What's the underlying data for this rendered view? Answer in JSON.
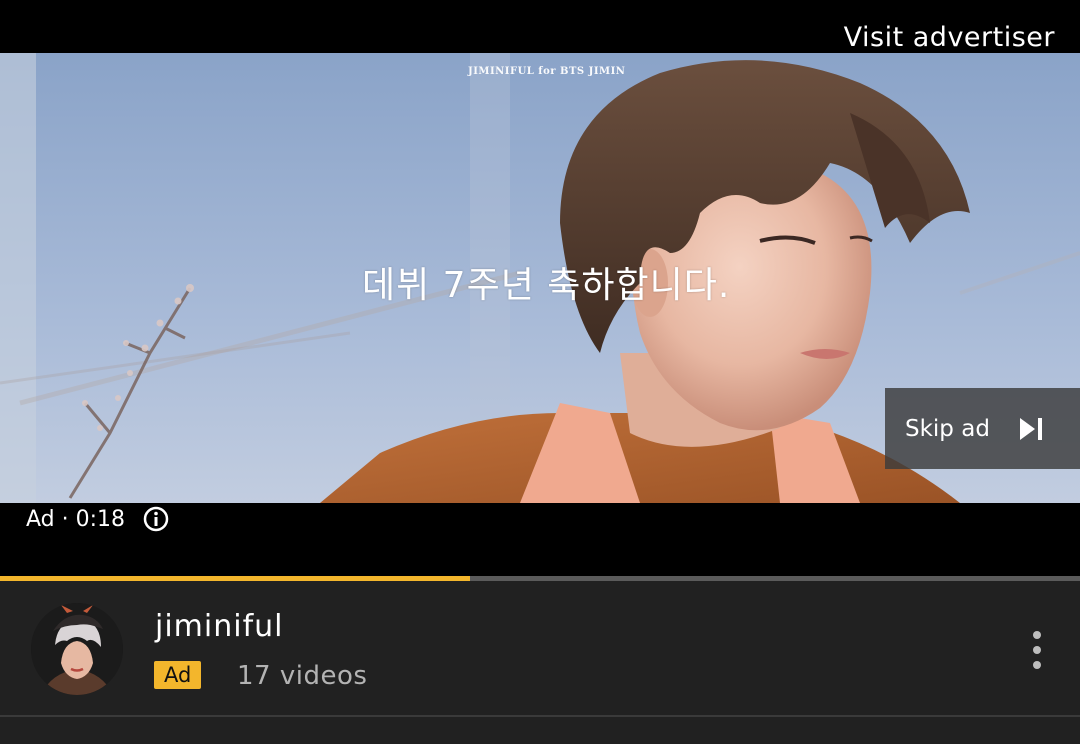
{
  "player": {
    "visit_advertiser_label": "Visit advertiser",
    "watermark": "JIMINIFUL for BTS JIMIN",
    "caption": "데뷔 7주년 축하합니다.",
    "skip_ad_label": "Skip ad",
    "ad_timer": "Ad · 0:18",
    "progress": 0.435
  },
  "channel": {
    "name": "jiminiful",
    "ad_badge": "Ad",
    "video_count": "17 videos"
  },
  "icons": {
    "skip": "skip-next-icon",
    "info": "info-icon",
    "more": "more-vert-icon"
  },
  "colors": {
    "accent": "#f3b62c",
    "panel_bg": "#212121",
    "skip_bg": "#3c3c3c"
  }
}
